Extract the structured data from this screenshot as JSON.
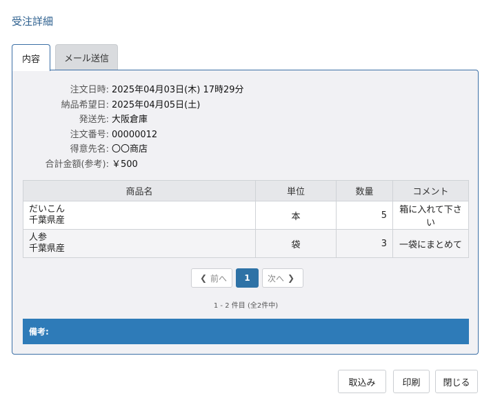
{
  "page_title": "受注詳細",
  "tabs": [
    {
      "label": "内容",
      "active": true
    },
    {
      "label": "メール送信",
      "active": false
    }
  ],
  "info": [
    {
      "label": "注文日時:",
      "value": "2025年04月03日(木) 17時29分"
    },
    {
      "label": "納品希望日:",
      "value": "2025年04月05日(土)"
    },
    {
      "label": "発送先:",
      "value": "大阪倉庫"
    },
    {
      "label": "注文番号:",
      "value": "00000012"
    },
    {
      "label": "得意先名:",
      "value": "〇〇商店"
    },
    {
      "label": "合計金額(参考):",
      "value": "￥500"
    }
  ],
  "table": {
    "headers": [
      "商品名",
      "単位",
      "数量",
      "コメント"
    ],
    "rows": [
      {
        "name_line1": "だいこん",
        "name_line2": "千葉県産",
        "unit": "本",
        "qty": "5",
        "comment": "箱に入れて下さい"
      },
      {
        "name_line1": "人参",
        "name_line2": "千葉県産",
        "unit": "袋",
        "qty": "3",
        "comment": "一袋にまとめて"
      }
    ]
  },
  "pager": {
    "prev": "前へ",
    "current": "1",
    "next": "次へ",
    "summary": "1 - 2 件目 (全2件中)"
  },
  "remarks_label": "備考:",
  "buttons": {
    "import": "取込み",
    "print": "印刷",
    "close": "閉じる"
  },
  "colors": {
    "accent": "#2e7bb8",
    "title": "#2c5f8e",
    "border": "#3a6ea5"
  }
}
